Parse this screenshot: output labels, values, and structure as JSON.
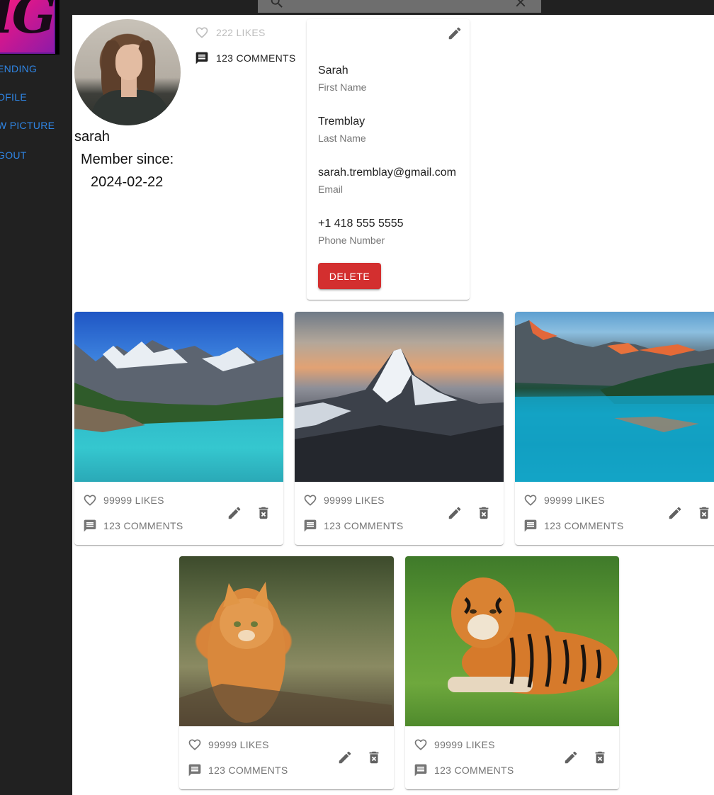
{
  "app": {
    "logo_text": "IG"
  },
  "sidebar": {
    "items": [
      {
        "label": "ENDING"
      },
      {
        "label": "OFILE"
      },
      {
        "label": "W PICTURE"
      },
      {
        "label": "GOUT"
      }
    ]
  },
  "profile": {
    "username": "sarah",
    "member_since_label": "Member since:",
    "member_since_date": "2024-02-22",
    "likes": "222 LIKES",
    "comments": "123 COMMENTS"
  },
  "info": {
    "first_name": "Sarah",
    "first_name_label": "First Name",
    "last_name": "Tremblay",
    "last_name_label": "Last Name",
    "email": "sarah.tremblay@gmail.com",
    "email_label": "Email",
    "phone": "+1 418 555 5555",
    "phone_label": "Phone Number",
    "delete_label": "DELETE"
  },
  "pictures": [
    {
      "subject": "mountain-lake",
      "likes": "99999 LIKES",
      "comments": "123 COMMENTS"
    },
    {
      "subject": "snowy-peak",
      "likes": "99999 LIKES",
      "comments": "123 COMMENTS"
    },
    {
      "subject": "moraine-lake",
      "likes": "99999 LIKES",
      "comments": "123 COMMENTS"
    },
    {
      "subject": "orange-cat",
      "likes": "99999 LIKES",
      "comments": "123 COMMENTS"
    },
    {
      "subject": "tiger",
      "likes": "99999 LIKES",
      "comments": "123 COMMENTS"
    }
  ],
  "colors": {
    "sidebar_bg": "#212121",
    "nav_link": "#2f86e6",
    "delete": "#d32f2f",
    "muted": "#757575"
  }
}
